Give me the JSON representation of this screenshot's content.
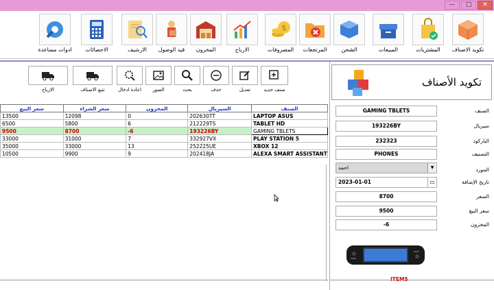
{
  "window": {
    "min": "—",
    "max": "□",
    "close": "✕"
  },
  "nav": [
    {
      "label": "تكويد الاصناف",
      "icon": "box-icon"
    },
    {
      "label": "المشتريات",
      "icon": "shopping-bag-icon"
    },
    {
      "label": "المبيعات",
      "icon": "archive-box-icon"
    },
    {
      "label": "الشحن",
      "icon": "delivery-box-icon"
    },
    {
      "label": "المرتجعات",
      "icon": "folder-cancel-icon"
    },
    {
      "label": "المصروفات",
      "icon": "coins-icon"
    },
    {
      "label": "الارباح",
      "icon": "growth-chart-icon"
    },
    {
      "label": "المخزون",
      "icon": "warehouse-icon"
    },
    {
      "label": "قيد الوصول",
      "icon": "delivery-man-icon"
    },
    {
      "label": "الارشيف",
      "icon": "document-search-icon"
    },
    {
      "label": "الاحصائات",
      "icon": "calculator-icon"
    },
    {
      "label": "ادوات مساعدة",
      "icon": "settings-tools-icon"
    }
  ],
  "toolbar": [
    {
      "label": "صنف جديد",
      "icon": "add-icon"
    },
    {
      "label": "تعديل",
      "icon": "edit-icon"
    },
    {
      "label": "حذف",
      "icon": "minus-icon"
    },
    {
      "label": "بحث",
      "icon": "search-icon"
    },
    {
      "label": "الصور",
      "icon": "image-icon"
    },
    {
      "label": "اعادة ادخال",
      "icon": "gear-search-icon"
    },
    {
      "label": "تتبع الاصناف",
      "icon": "truck-icon"
    },
    {
      "label": "الارباح",
      "icon": "truck-icon"
    }
  ],
  "table": {
    "columns": [
      "سعر البيع",
      "سعر الشراء",
      "المخزون",
      "السيريال",
      "الصنف"
    ],
    "rows": [
      [
        "13500",
        "12098",
        "0",
        "202630TT",
        "LAPTOP ASUS"
      ],
      [
        "6500",
        "5800",
        "6",
        "212229TS",
        "TABLET HD"
      ],
      [
        "9500",
        "8700",
        "-6",
        "193226BY",
        "GAMING TBLETS"
      ],
      [
        "33000",
        "31000",
        "7",
        "332927VX",
        "PLAY STATION 5"
      ],
      [
        "35000",
        "33000",
        "13",
        "252225UE",
        "XBOX 12"
      ],
      [
        "10500",
        "9900",
        "9",
        "202418JA",
        "ALEXA SMART ASSISTANT"
      ]
    ],
    "selected_index": 2
  },
  "panel": {
    "title": "تكويد الأصناف",
    "fields": [
      {
        "label": "الصنف",
        "value": "GAMING TBLETS"
      },
      {
        "label": "سيريال",
        "value": "193226BY"
      },
      {
        "label": "الباركود",
        "value": "232323"
      },
      {
        "label": "التصنيف",
        "value": "PHONES"
      },
      {
        "label": "المورد",
        "value": "احمد"
      },
      {
        "label": "تاريخ الإضافة",
        "value": "2023-01-01"
      },
      {
        "label": "السعر",
        "value": "8700"
      },
      {
        "label": "سعر البيع",
        "value": "9500"
      },
      {
        "label": "المخزون",
        "value": "-6"
      }
    ],
    "image_caption": "ITEMS"
  }
}
